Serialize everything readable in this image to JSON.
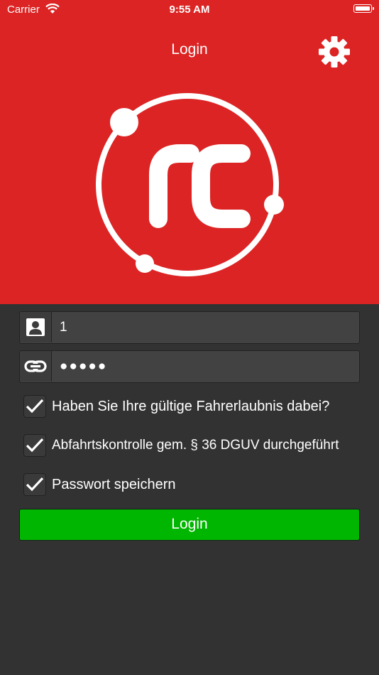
{
  "status_bar": {
    "carrier": "Carrier",
    "time": "9:55 AM",
    "wifi_icon": "wifi-icon",
    "battery_icon": "battery-icon"
  },
  "nav": {
    "title": "Login",
    "settings_icon": "gear-icon"
  },
  "logo": {
    "text": "rc",
    "icon": "rc-logo"
  },
  "form": {
    "username": {
      "icon": "user-card-icon",
      "value": "1"
    },
    "password": {
      "icon": "link-icon",
      "value": "●●●●●"
    },
    "checkboxes": [
      {
        "label": "Haben Sie Ihre gültige Fahrerlaubnis dabei?",
        "checked": true
      },
      {
        "label": "Abfahrtskontrolle gem. § 36 DGUV durchgeführt",
        "checked": true
      },
      {
        "label": "Passwort speichern",
        "checked": true
      }
    ],
    "login_label": "Login"
  },
  "colors": {
    "header_red": "#dc2424",
    "background_dark": "#323232",
    "login_green": "#00b600"
  }
}
